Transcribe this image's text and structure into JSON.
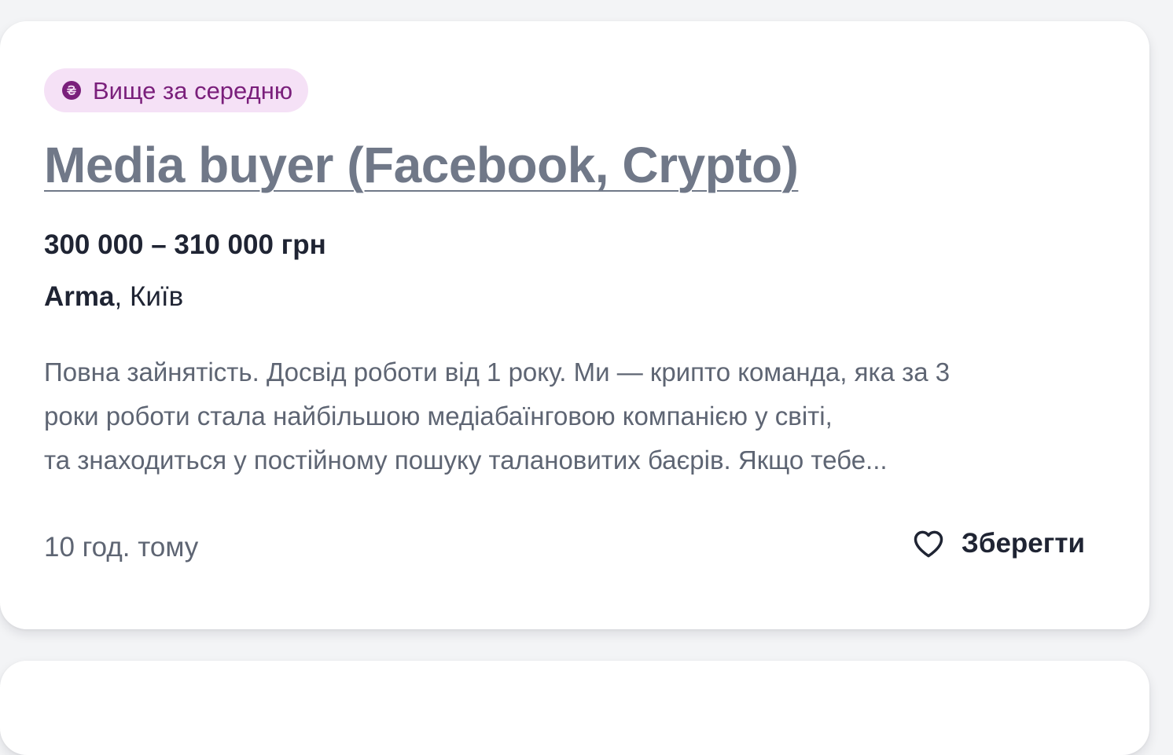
{
  "vacancy": {
    "badge": {
      "icon": "hryvnia-coin-icon",
      "label": "Вище за середню",
      "background": "#f5e1f6",
      "color": "#7a1f7b"
    },
    "title": "Media buyer (Facebook, Crypto)",
    "salary": "300 000 – 310 000 грн",
    "company": "Arma",
    "location_separator": ", ",
    "location": "Київ",
    "description_lines": [
      "Повна зайнятість. Досвід роботи від 1 року. Ми — крипто команда, яка за 3",
      "роки роботи стала найбільшою медіабаїнговою компанією у світі,",
      "та знаходиться у постійному пошуку талановитих баєрів. Якщо тебе..."
    ],
    "posted": "10 год. тому",
    "save": {
      "icon": "heart-outline-icon",
      "label": "Зберегти"
    }
  },
  "colors": {
    "page_background": "#f3f4f6",
    "card_background": "#ffffff",
    "title": "#707888",
    "text_dark": "#1f2433",
    "text_muted": "#5e6573"
  }
}
